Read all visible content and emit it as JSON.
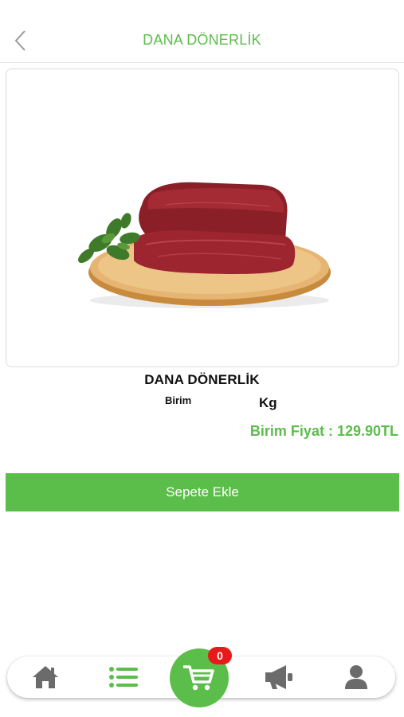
{
  "header": {
    "title": "DANA DÖNERLİK"
  },
  "product": {
    "name": "DANA DÖNERLİK",
    "unit_label": "Birim",
    "unit_value": "Kg",
    "price_text": "Birim Fiyat : 129.90TL"
  },
  "actions": {
    "add_to_cart_label": "Sepete Ekle"
  },
  "tabbar": {
    "cart_count": "0",
    "items": [
      "home-icon",
      "list-icon",
      "cart-icon",
      "megaphone-icon",
      "user-icon"
    ]
  },
  "colors": {
    "accent": "#5bbd4a",
    "badge": "#e8191a",
    "icon_gray": "#6b6b6b"
  }
}
